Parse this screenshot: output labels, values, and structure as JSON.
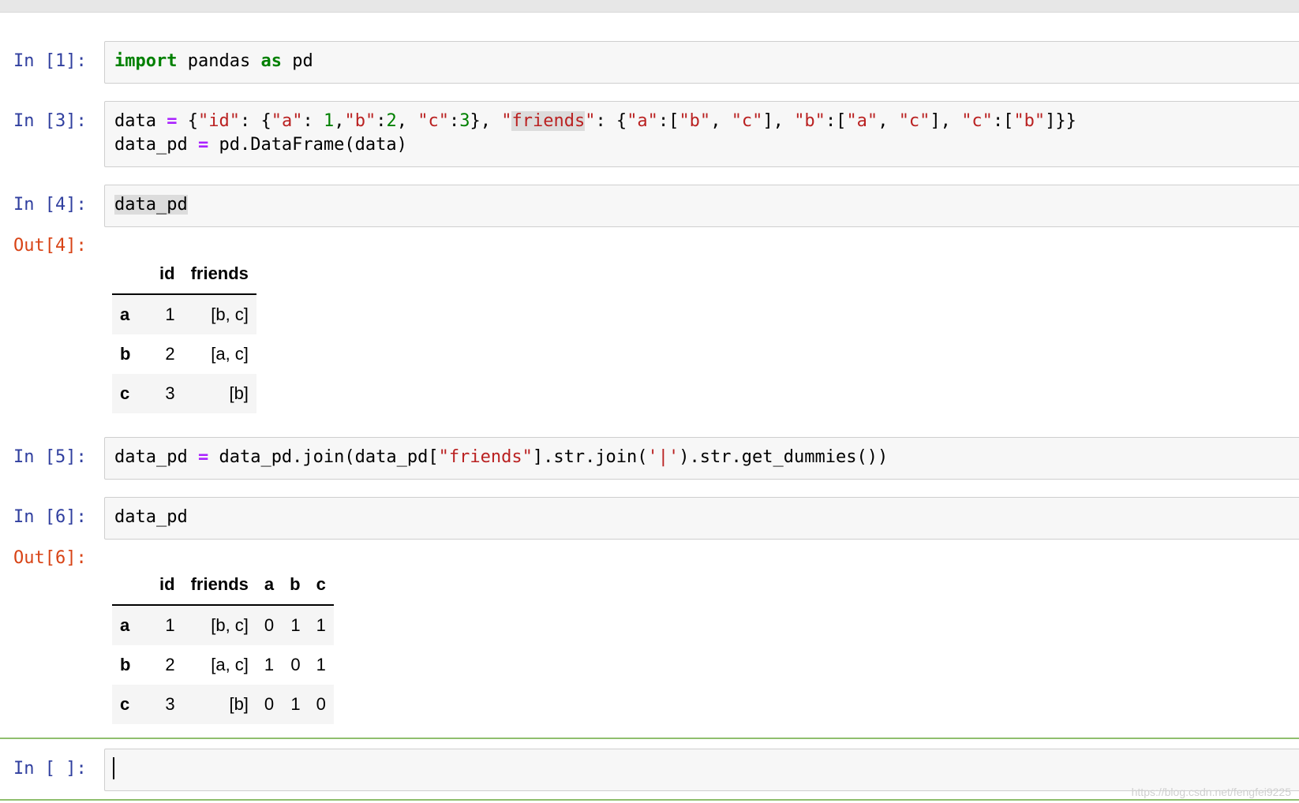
{
  "cells": [
    {
      "prompt": "In [1]:"
    },
    {
      "prompt": "In [3]:"
    },
    {
      "prompt": "In [4]:",
      "code": "data_pd",
      "out_prompt": "Out[4]:"
    },
    {
      "prompt": "In [5]:"
    },
    {
      "prompt": "In [6]:",
      "code": "data_pd",
      "out_prompt": "Out[6]:"
    },
    {
      "prompt": "In [ ]:"
    }
  ],
  "out4": {
    "columns": [
      "id",
      "friends"
    ],
    "rows": [
      {
        "index": "a",
        "id": "1",
        "friends": "[b, c]"
      },
      {
        "index": "b",
        "id": "2",
        "friends": "[a, c]"
      },
      {
        "index": "c",
        "id": "3",
        "friends": "[b]"
      }
    ]
  },
  "out6": {
    "columns": [
      "id",
      "friends",
      "a",
      "b",
      "c"
    ],
    "rows": [
      {
        "index": "a",
        "id": "1",
        "friends": "[b, c]",
        "a": "0",
        "b": "1",
        "c": "1"
      },
      {
        "index": "b",
        "id": "2",
        "friends": "[a, c]",
        "a": "1",
        "b": "0",
        "c": "1"
      },
      {
        "index": "c",
        "id": "3",
        "friends": "[b]",
        "a": "0",
        "b": "1",
        "c": "0"
      }
    ]
  },
  "watermark": "https://blog.csdn.net/fengfei9225"
}
